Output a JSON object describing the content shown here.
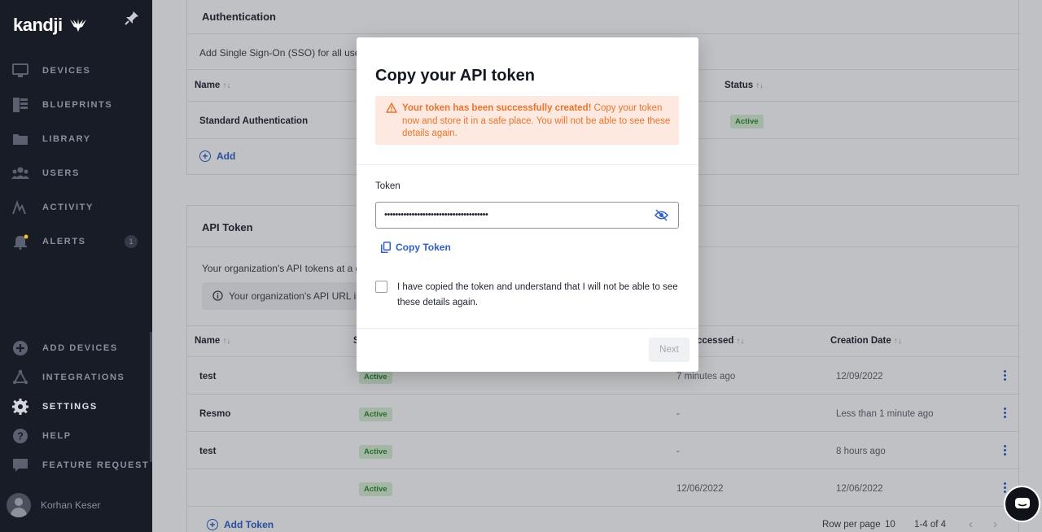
{
  "sidebar": {
    "logo": "kandji",
    "items": [
      {
        "label": "DEVICES"
      },
      {
        "label": "BLUEPRINTS"
      },
      {
        "label": "LIBRARY"
      },
      {
        "label": "USERS"
      },
      {
        "label": "ACTIVITY"
      },
      {
        "label": "ALERTS",
        "badge": "1"
      },
      {
        "label": "ADD DEVICES"
      },
      {
        "label": "INTEGRATIONS"
      },
      {
        "label": "SETTINGS"
      },
      {
        "label": "HELP"
      },
      {
        "label": "FEATURE REQUEST"
      }
    ],
    "user_name": "Korhan Keser"
  },
  "auth": {
    "title": "Authentication",
    "description": "Add Single Sign-On (SSO) for all users",
    "col_name": "Name",
    "col_status": "Status",
    "sort_glyph": "↑↓",
    "row_name": "Standard Authentication",
    "row_status": "Active",
    "add_label": "Add"
  },
  "api": {
    "title": "API Token",
    "description": "Your organization's API tokens at a gla",
    "url_text": "Your organization's API URL is:",
    "col_name": "Name",
    "col_status": "S",
    "col_accessed": "ccessed",
    "col_created": "Creation Date",
    "rows": [
      {
        "name": "test",
        "status": "Active",
        "accessed": "7 minutes ago",
        "created": "12/09/2022"
      },
      {
        "name": "Resmo",
        "status": "Active",
        "accessed": "-",
        "created": "Less than 1 minute ago"
      },
      {
        "name": "test",
        "status": "Active",
        "accessed": "-",
        "created": "8 hours ago"
      },
      {
        "name": "",
        "status": "Active",
        "accessed": "12/06/2022",
        "created": "12/06/2022"
      }
    ],
    "add_label": "Add Token",
    "rows_per_page_label": "Row per page",
    "rows_per_page": "10",
    "range": "1-4 of 4"
  },
  "modal": {
    "title": "Copy your API token",
    "alert_bold": "Your token has been successfully created!",
    "alert_text": " Copy your token now and store it in a safe place. You will not be able to see these details again.",
    "token_label": "Token",
    "token_value": "••••••••••••••••••••••••••••••••••••••",
    "copy_label": "Copy Token",
    "checkbox_text": "I have copied the token and understand that I will not be able to see these details again.",
    "next_label": "Next"
  },
  "colors": {
    "accent": "#2f5fc8",
    "warning": "#e8742f",
    "sidebar": "#171c27",
    "active_pill": "#2f8a2c"
  }
}
